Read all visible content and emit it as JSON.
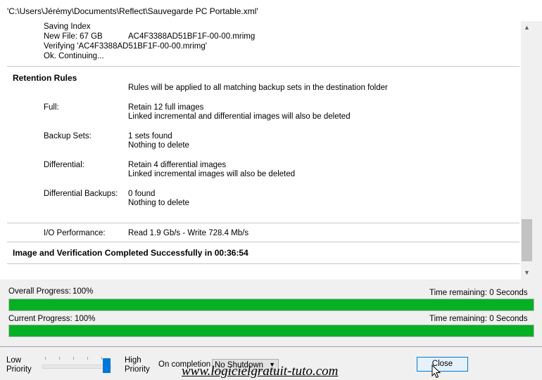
{
  "window": {
    "title": "'C:\\Users\\Jérémy\\Documents\\Reflect\\Sauvegarde PC Portable.xml'"
  },
  "log": {
    "saving": {
      "line1": "Saving Index",
      "new_file_label": "New File: 67 GB",
      "new_file_name": "AC4F3388AD51BF1F-00-00.mrimg",
      "verifying": "Verifying 'AC4F3388AD51BF1F-00-00.mrimg'",
      "ok": "Ok. Continuing..."
    },
    "retention": {
      "heading": "Retention Rules",
      "intro": "Rules will be applied to all matching backup sets in the destination folder",
      "full_label": "Full:",
      "full_line1": "Retain 12 full images",
      "full_line2": "Linked incremental and differential images will also be deleted",
      "sets_label": "Backup Sets:",
      "sets_line1": "1 sets found",
      "sets_line2": "Nothing to delete",
      "diff_label": "Differential:",
      "diff_line1": "Retain 4 differential images",
      "diff_line2": "Linked incremental images will also be deleted",
      "diffb_label": "Differential Backups:",
      "diffb_line1": "0 found",
      "diffb_line2": "Nothing to delete"
    },
    "io_label": "I/O Performance:",
    "io_value": "Read 1.9 Gb/s - Write 728.4 Mb/s",
    "completed": "Image and Verification Completed Successfully in 00:36:54"
  },
  "progress": {
    "overall_label": "Overall Progress:",
    "overall_value": "100%",
    "overall_remaining": "Time remaining: 0 Seconds",
    "overall_fraction": 1.0,
    "current_label": "Current Progress:",
    "current_value": "100%",
    "current_remaining": "Time remaining: 0 Seconds",
    "current_fraction": 1.0
  },
  "controls": {
    "priority_low_1": "Low",
    "priority_low_2": "Priority",
    "priority_high_1": "High",
    "priority_high_2": "Priority",
    "priority_level": 1.0,
    "completion_label": "On completion",
    "completion_value": "No Shutdown",
    "close_label": "Close"
  },
  "watermark": "www.logicielgratuit-tuto.com",
  "colors": {
    "progress_fill": "#06b025",
    "close_border": "#0078d7",
    "slider_thumb": "#0078d7"
  },
  "icons": {
    "scroll_up": "chevron-up-icon",
    "scroll_down": "chevron-down-icon",
    "select_arrow": "chevron-down-icon",
    "cursor": "mouse-pointer-icon"
  }
}
